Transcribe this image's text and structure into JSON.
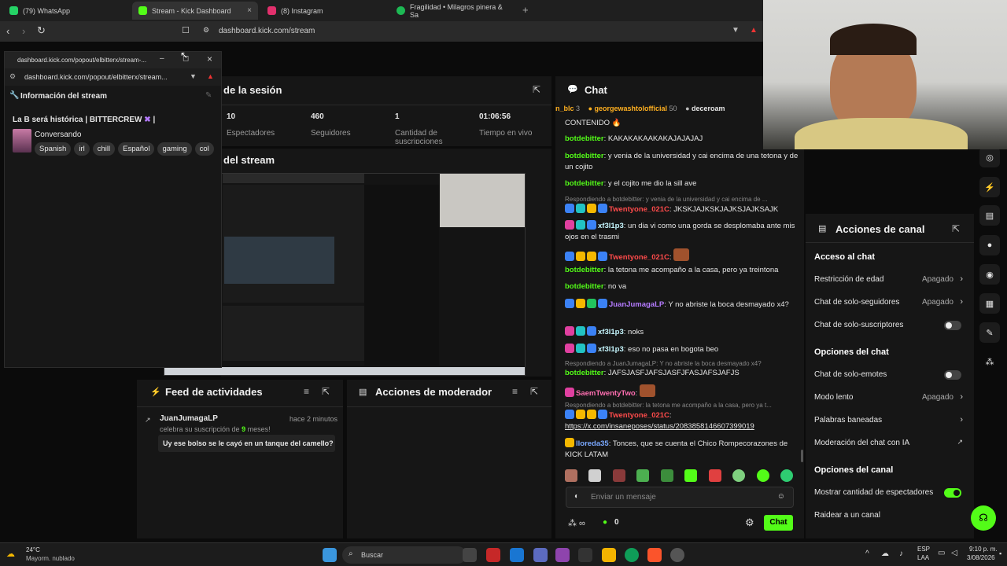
{
  "browser": {
    "tabs": [
      {
        "label": "(79) WhatsApp",
        "color": "#25d366"
      },
      {
        "label": "Stream - Kick Dashboard",
        "color": "#53fc18"
      },
      {
        "label": "(8) Instagram",
        "color": "#e1306c"
      },
      {
        "label": "Fragilidad • Milagros pinera & Sa",
        "color": "#1db954"
      }
    ],
    "close_symbol": "×",
    "new_tab": "+",
    "url": "dashboard.kick.com/stream"
  },
  "popout": {
    "title_url": "dashboard.kick.com/popout/elbitterx/stream-...",
    "url": "dashboard.kick.com/popout/elbitterx/stream...",
    "header": "Información del stream",
    "stream_title": "La B será histórica | BITTERCREW",
    "category": "Conversando",
    "tags": [
      "Spanish",
      "irl",
      "chill",
      "Español",
      "gaming",
      "col"
    ]
  },
  "session": {
    "header": "de la sesión",
    "stats": [
      {
        "value": "10",
        "label": "Espectadores"
      },
      {
        "value": "460",
        "label": "Seguidores"
      },
      {
        "value": "1",
        "label": "Cantidad de suscripciones"
      },
      {
        "value": "01:06:56",
        "label": "Tiempo en vivo"
      }
    ]
  },
  "preview": {
    "header": "del stream"
  },
  "activity": {
    "header": "Feed de actividades",
    "item_user": "JuanJumagaLP",
    "item_time": "hace 2 minutos",
    "item_text_a": "celebra su suscripción de",
    "item_months": "9",
    "item_text_b": "meses!",
    "item_message": "Uy ese bolso se le cayó en un tanque del camello?"
  },
  "moderator": {
    "header": "Acciones de moderador"
  },
  "chat": {
    "header": "Chat",
    "top_users": [
      {
        "name": "n_blc",
        "count": "3"
      },
      {
        "name": "georgewashtolofficial",
        "count": "50"
      },
      {
        "name": "deceroam",
        "count": ""
      }
    ],
    "lines": [
      {
        "user": "",
        "text": "CONTENIDO 🔥",
        "color": "#e6e6e6"
      },
      {
        "user": "botdebitter",
        "text": "KAKAKAKAAKAKAJAJAJAJ",
        "color": "#53fc18"
      },
      {
        "user": "botdebitter",
        "text": "y venia de la universidad y cai encima de una tetona y de un cojito",
        "color": "#53fc18"
      },
      {
        "user": "botdebitter",
        "text": "y el cojito me dio la sill ave",
        "color": "#53fc18"
      },
      {
        "user": "Twentyone_021C",
        "text": "JKSKJAJKSKJAJKSJAJKSAJK",
        "color": "#ff4b4b",
        "reply": "Respondiendo a botdebitter: y venia de la universidad y cai encima de ..."
      },
      {
        "user": "xf3l1p3",
        "text": "un dia vi como una gorda se desplomaba ante mis ojos en el trasmi",
        "color": "#c6f7ff"
      },
      {
        "user": "Twentyone_021C",
        "text": "",
        "color": "#ff4b4b"
      },
      {
        "user": "botdebitter",
        "text": "la tetona me acompaño a la casa, pero ya treintona",
        "color": "#53fc18"
      },
      {
        "user": "botdebitter",
        "text": "no va",
        "color": "#53fc18"
      },
      {
        "user": "JuanJumagaLP",
        "text": "Y no abriste la boca desmayado x4?",
        "color": "#b57bff"
      },
      {
        "user": "xf3l1p3",
        "text": "noks",
        "color": "#c6f7ff"
      },
      {
        "user": "xf3l1p3",
        "text": "eso no pasa en bogota beo",
        "color": "#c6f7ff"
      },
      {
        "user": "botdebitter",
        "text": "JAFSJASFJAFSJASFJFASJAFSJAFJS",
        "color": "#53fc18",
        "reply": "Respondiendo a JuanJumagaLP: Y no abriste la boca desmayado x4?"
      },
      {
        "user": "SaemTwentyTwo",
        "text": "",
        "color": "#ff6fb1"
      },
      {
        "user": "Twentyone_021C",
        "text": "https://x.com/insaneposes/status/2083858146607399019",
        "color": "#ff4b4b",
        "reply": "Respondiendo a botdebitter: la tetona me acompaño a la casa, pero ya t..."
      },
      {
        "user": "lloreda35",
        "text": "Tonces, que se cuenta el Chico Rompecorazones de KICK LATAM",
        "color": "#7aa8ff"
      }
    ],
    "input_placeholder": "Enviar un mensaje",
    "points": "0",
    "send_label": "Chat"
  },
  "channel_actions": {
    "header": "Acciones de canal",
    "sec_access": "Acceso al chat",
    "age": "Restricción de edad",
    "age_val": "Apagado",
    "followers": "Chat de solo-seguidores",
    "followers_val": "Apagado",
    "subs": "Chat de solo-suscriptores",
    "sec_chat": "Opciones del chat",
    "emotes": "Chat de solo-emotes",
    "slow": "Modo lento",
    "slow_val": "Apagado",
    "banned": "Palabras baneadas",
    "ai_mod": "Moderación del chat con IA",
    "sec_channel": "Opciones del canal",
    "viewers": "Mostrar cantidad de espectadores",
    "raid": "Raidear a un canal"
  },
  "taskbar": {
    "weather_temp": "24°C",
    "weather_desc": "Mayorm. nublado",
    "search": "Buscar",
    "lang1": "ESP",
    "lang2": "LAA",
    "time": "9:10 p. m.",
    "date": "3/08/2026"
  }
}
